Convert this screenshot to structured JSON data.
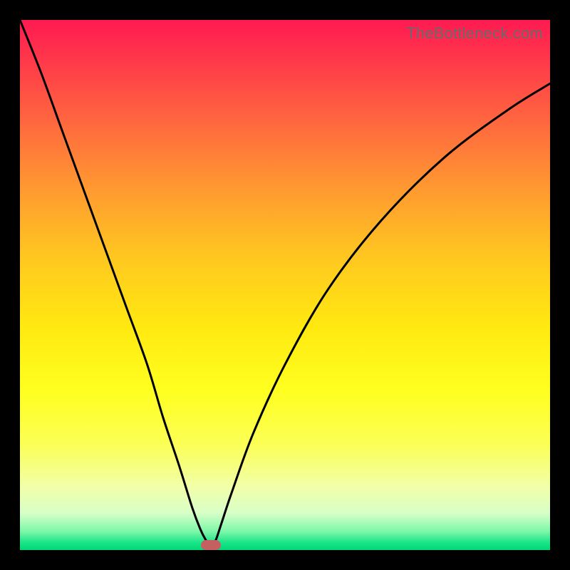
{
  "watermark": "TheBottleneck.com",
  "chart_data": {
    "type": "line",
    "title": "",
    "xlabel": "",
    "ylabel": "",
    "xlim": [
      0,
      100
    ],
    "ylim": [
      0,
      100
    ],
    "grid": false,
    "background_gradient": {
      "direction": "vertical",
      "stops": [
        {
          "pos": 0,
          "color": "#ff1a52"
        },
        {
          "pos": 50,
          "color": "#ffe910"
        },
        {
          "pos": 100,
          "color": "#00d878"
        }
      ]
    },
    "series": [
      {
        "name": "bottleneck-curve",
        "color": "#000000",
        "x": [
          0,
          4,
          8,
          12,
          16,
          20,
          24,
          27,
          30,
          32.5,
          34,
          35,
          35.8,
          36.5,
          37,
          38,
          40,
          44,
          50,
          58,
          68,
          80,
          92,
          100
        ],
        "y": [
          100,
          90,
          79,
          68,
          57,
          46,
          35,
          25,
          16,
          8,
          4,
          2,
          1,
          1.3,
          2,
          5,
          11,
          22,
          35,
          49,
          62,
          74,
          83,
          88
        ]
      }
    ],
    "marker": {
      "name": "optimal-point",
      "x": 36,
      "y": 1,
      "color": "#c46060"
    }
  }
}
